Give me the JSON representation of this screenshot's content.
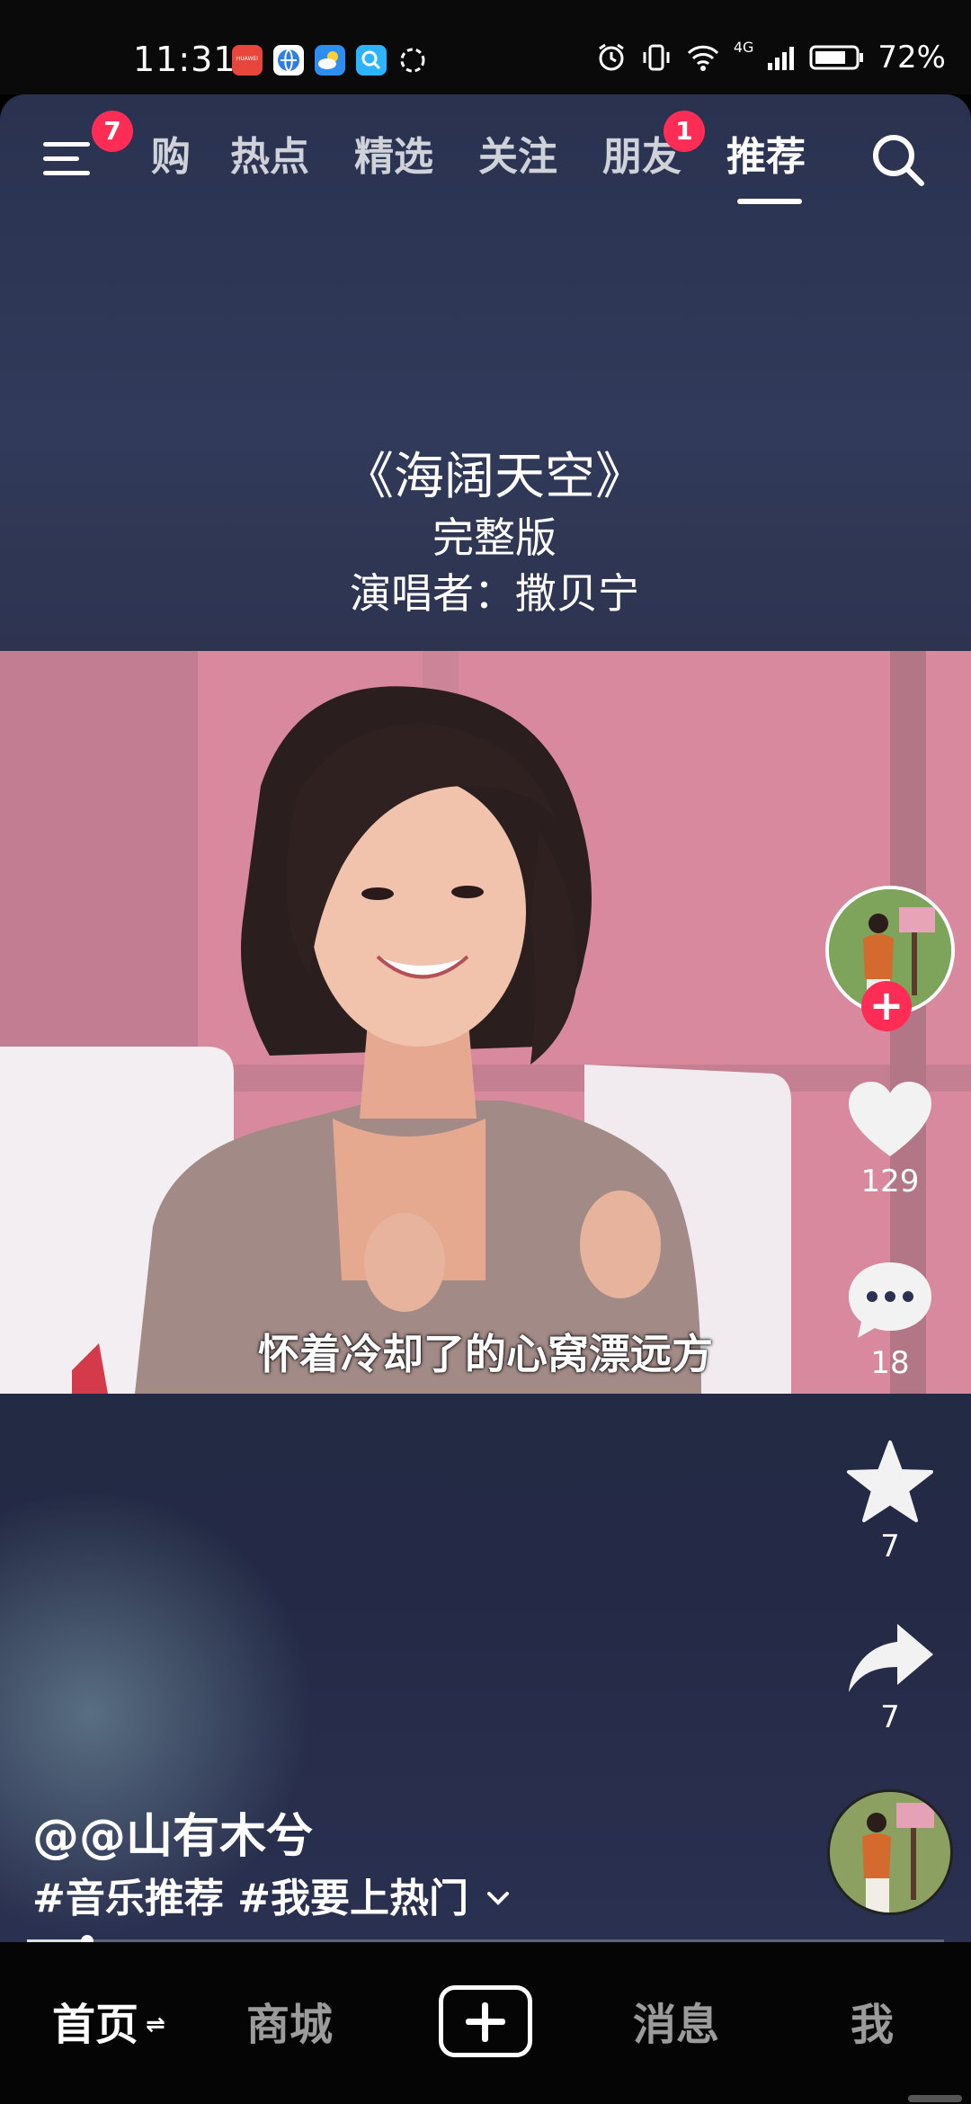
{
  "status_bar": {
    "time": "11:31",
    "battery": "72%",
    "network": "4G",
    "app_icons": [
      "huawei-appgallery-icon",
      "browser-icon",
      "weather-icon",
      "search-app-icon",
      "loading-circle-icon"
    ],
    "app_label": "HUAWEI"
  },
  "top_nav": {
    "menu_badge": "7",
    "tabs": [
      {
        "label": "购"
      },
      {
        "label": "热点"
      },
      {
        "label": "精选"
      },
      {
        "label": "关注"
      },
      {
        "label": "朋友"
      },
      {
        "label": "推荐"
      }
    ],
    "friends_badge": "1",
    "active_tab": "推荐"
  },
  "video_title": {
    "line1": "《海阔天空》",
    "line2": "完整版",
    "line3": "演唱者：撒贝宁"
  },
  "video": {
    "subtitle": "怀着冷却了的心窝漂远方"
  },
  "side_actions": {
    "likes": "129",
    "comments": "18",
    "favorites": "7",
    "shares": "7",
    "follow_symbol": "+"
  },
  "post": {
    "author": "@@山有木兮",
    "tags": "#音乐推荐 #我要上热门",
    "progress_fraction": 0.066
  },
  "bottom_nav": {
    "items": [
      {
        "label": "首页"
      },
      {
        "label": "商城"
      },
      {
        "label": "消息"
      },
      {
        "label": "我"
      }
    ],
    "home_refresh_symbol": "⇌"
  },
  "colors": {
    "accent": "#ff2d55",
    "background": "#232a45"
  }
}
